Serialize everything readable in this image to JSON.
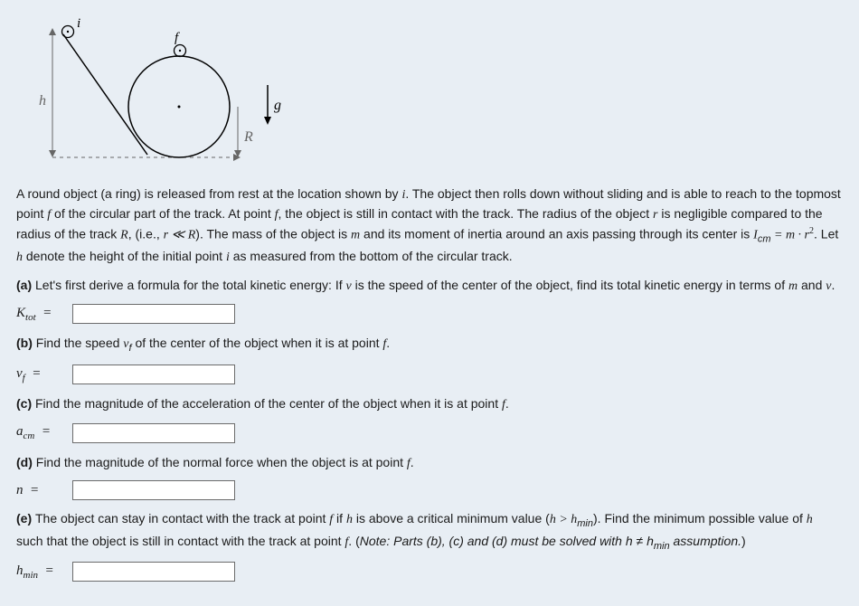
{
  "diagram": {
    "labels": {
      "h": "h",
      "i": "i",
      "f": "f",
      "g": "g",
      "R": "R"
    }
  },
  "problem": {
    "intro_parts": {
      "p1a": "A round object (a ring) is released from rest at the location shown by ",
      "i": "i",
      "p1b": ". The object then rolls down without sliding and is able to reach to the topmost point ",
      "f": "f",
      "p1c": " of the circular part of the track. At point ",
      "p1d": ", the object is still in contact with the track. The radius of the object ",
      "r": "r",
      "p1e": " is negligible compared to the radius of the track ",
      "R": "R",
      "p1f": ", (i.e., ",
      "rel": "r ≪ R",
      "p1g": "). The mass of the object is ",
      "m": "m",
      "p1h": " and its moment of inertia around an axis passing through its center is ",
      "Icm": "I",
      "cm": "cm",
      "eq": " = m · r",
      "sq": "2",
      "p1i": ". Let ",
      "h": "h",
      "p1j": " denote the height of the initial point ",
      "p1k": " as measured from the bottom of the circular track."
    },
    "a": {
      "prefix": "(a) ",
      "text1": "Let's first derive a formula for the total kinetic energy: If ",
      "v": "v",
      "text2": " is the speed of the center of the object, find its total kinetic energy in terms of ",
      "m": "m",
      "and": " and ",
      "vdot": "v",
      "period": ".",
      "label_main": "K",
      "label_sub": "tot",
      "eq": "="
    },
    "b": {
      "prefix": "(b) ",
      "text1": "Find the speed ",
      "vf_v": "v",
      "vf_f": "f",
      "text2": " of the center of the object when it is at point ",
      "f": "f",
      "period": ".",
      "label_main": "v",
      "label_sub": "f",
      "eq": "="
    },
    "c": {
      "prefix": "(c) ",
      "text": "Find the magnitude of the acceleration of the center of the object when it is at point ",
      "f": "f",
      "period": ".",
      "label_main": "a",
      "label_sub": "cm",
      "eq": "="
    },
    "d": {
      "prefix": "(d) ",
      "text": "Find the magnitude of the normal force when the object is at point ",
      "f": "f",
      "period": ".",
      "label_main": "n",
      "eq": "="
    },
    "e": {
      "prefix": "(e) ",
      "text1": "The object can stay in contact with the track at point ",
      "f": "f",
      "text2": " if ",
      "h": "h",
      "text3": " is above a critical minimum value (",
      "hgt": "h > h",
      "min": "min",
      "text4": "). Find the minimum possible value of ",
      "text5": " such that the object is still in contact with the track at point ",
      "text6": ". (",
      "note": "Note: Parts (b), (c) and (d) must be solved with h ≠ h",
      "text7": " assumption.",
      "paren": ")",
      "label_main": "h",
      "label_sub": "min",
      "eq": "="
    }
  }
}
